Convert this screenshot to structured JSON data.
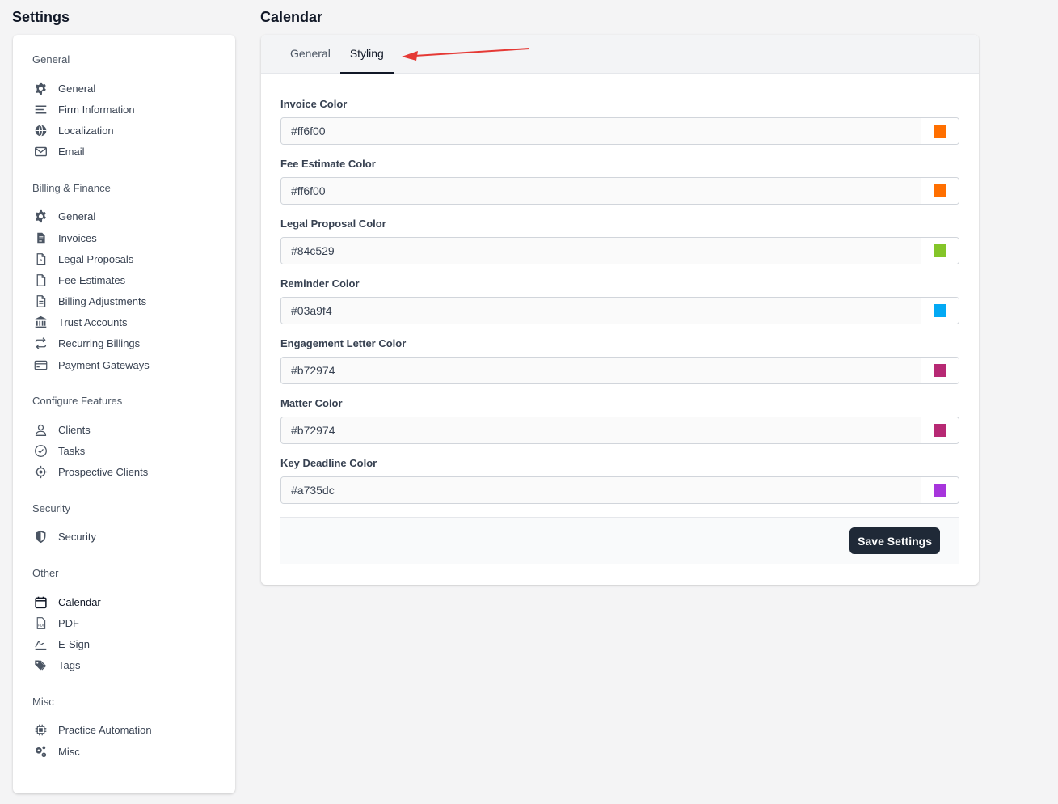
{
  "page": {
    "settings_title": "Settings",
    "section_title": "Calendar"
  },
  "sidebar": {
    "sections": [
      {
        "heading": "General",
        "items": [
          {
            "label": "General",
            "icon": "gear-icon"
          },
          {
            "label": "Firm Information",
            "icon": "lines-icon"
          },
          {
            "label": "Localization",
            "icon": "globe-icon"
          },
          {
            "label": "Email",
            "icon": "envelope-icon"
          }
        ]
      },
      {
        "heading": "Billing & Finance",
        "items": [
          {
            "label": "General",
            "icon": "gear-icon"
          },
          {
            "label": "Invoices",
            "icon": "invoice-icon"
          },
          {
            "label": "Legal Proposals",
            "icon": "document-p-icon"
          },
          {
            "label": "Fee Estimates",
            "icon": "document-icon"
          },
          {
            "label": "Billing Adjustments",
            "icon": "document-lines-icon"
          },
          {
            "label": "Trust Accounts",
            "icon": "bank-icon"
          },
          {
            "label": "Recurring Billings",
            "icon": "repeat-icon"
          },
          {
            "label": "Payment Gateways",
            "icon": "credit-card-icon"
          }
        ]
      },
      {
        "heading": "Configure Features",
        "items": [
          {
            "label": "Clients",
            "icon": "user-icon"
          },
          {
            "label": "Tasks",
            "icon": "check-circle-icon"
          },
          {
            "label": "Prospective Clients",
            "icon": "crosshair-icon"
          }
        ]
      },
      {
        "heading": "Security",
        "items": [
          {
            "label": "Security",
            "icon": "shield-icon"
          }
        ]
      },
      {
        "heading": "Other",
        "items": [
          {
            "label": "Calendar",
            "icon": "calendar-icon",
            "active": true
          },
          {
            "label": "PDF",
            "icon": "pdf-icon"
          },
          {
            "label": "E-Sign",
            "icon": "signature-icon"
          },
          {
            "label": "Tags",
            "icon": "tags-icon"
          }
        ]
      },
      {
        "heading": "Misc",
        "items": [
          {
            "label": "Practice Automation",
            "icon": "chip-icon"
          },
          {
            "label": "Misc",
            "icon": "gears-icon"
          }
        ]
      }
    ]
  },
  "tabs": [
    {
      "label": "General",
      "active": false
    },
    {
      "label": "Styling",
      "active": true
    }
  ],
  "annotation_color": "#e53935",
  "fields": [
    {
      "label": "Invoice Color",
      "value": "#ff6f00",
      "swatch": "#ff6f00"
    },
    {
      "label": "Fee Estimate Color",
      "value": "#ff6f00",
      "swatch": "#ff6f00"
    },
    {
      "label": "Legal Proposal Color",
      "value": "#84c529",
      "swatch": "#84c529"
    },
    {
      "label": "Reminder Color",
      "value": "#03a9f4",
      "swatch": "#03a9f4"
    },
    {
      "label": "Engagement Letter Color",
      "value": "#b72974",
      "swatch": "#b72974"
    },
    {
      "label": "Matter Color",
      "value": "#b72974",
      "swatch": "#b72974"
    },
    {
      "label": "Key Deadline Color",
      "value": "#a735dc",
      "swatch": "#a735dc"
    }
  ],
  "footer": {
    "save_label": "Save Settings"
  }
}
